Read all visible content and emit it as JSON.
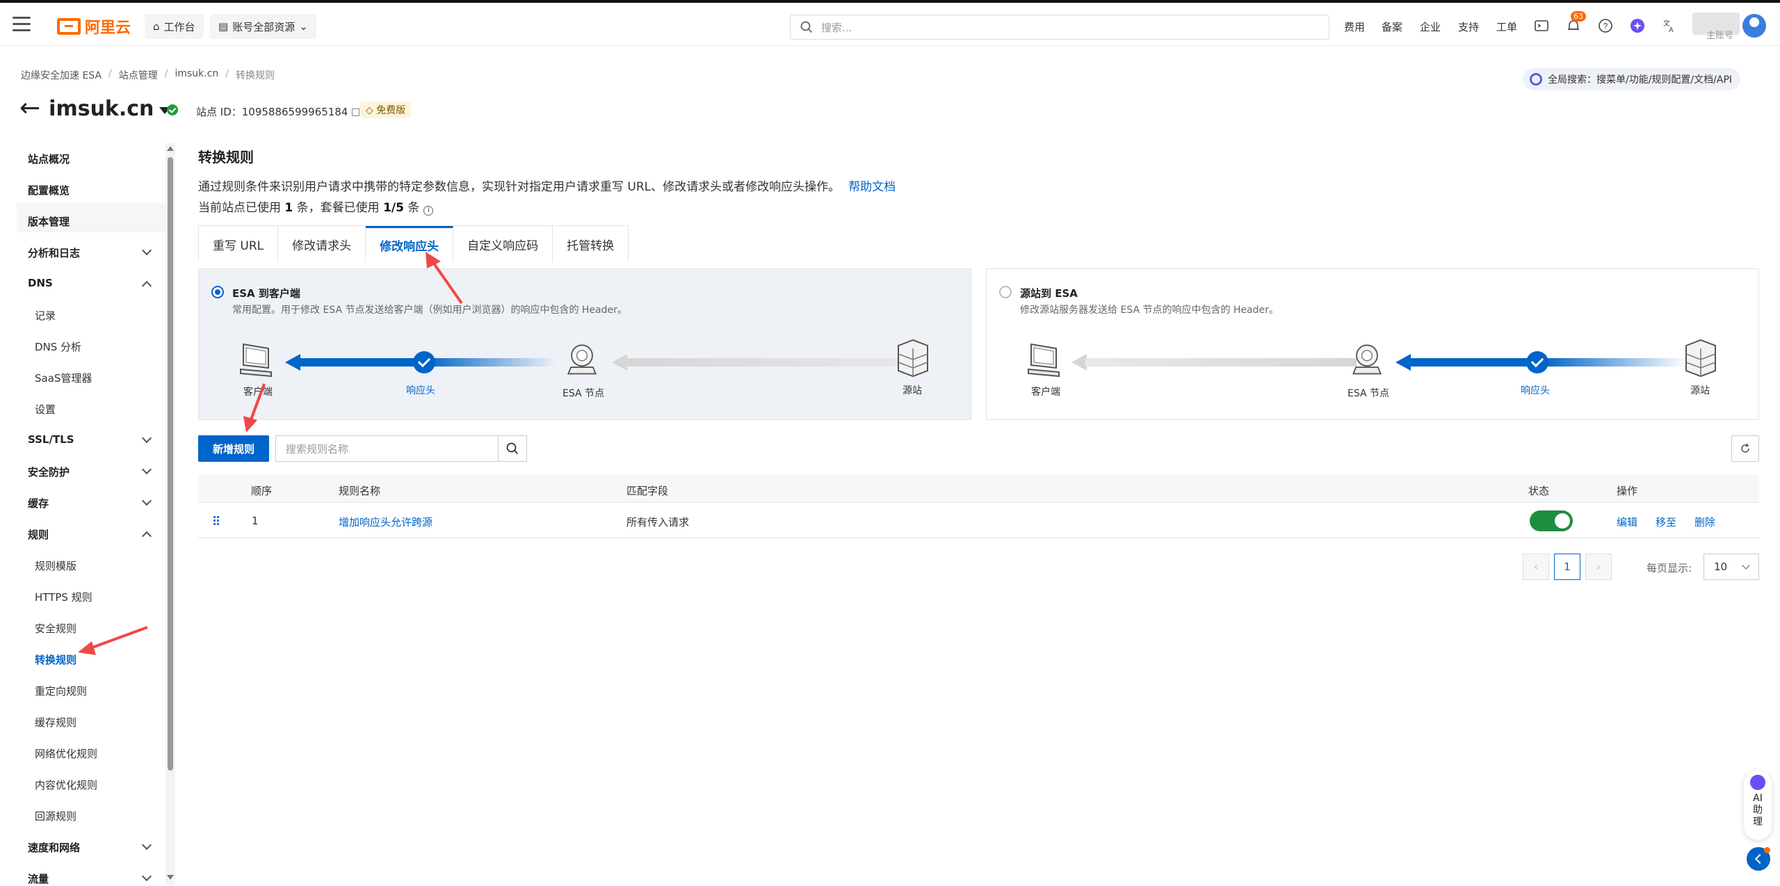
{
  "topbar": {
    "logo_text": "阿里云",
    "workbench": "工作台",
    "resources": "账号全部资源",
    "search_placeholder": "搜索...",
    "links": [
      "费用",
      "备案",
      "企业",
      "支持",
      "工单"
    ],
    "notification_count": "63",
    "user_name": "主账号"
  },
  "breadcrumb": [
    "边缘安全加速 ESA",
    "站点管理",
    "imsuk.cn",
    "转换规则"
  ],
  "global_search": "全局搜索：搜菜单/功能/规则配置/文档/API",
  "site": {
    "name": "imsuk.cn",
    "id_label": "站点 ID：1095886599965184",
    "plan_badge": "免费版"
  },
  "sidebar": {
    "items": [
      {
        "label": "站点概况",
        "type": "bold"
      },
      {
        "label": "配置概览",
        "type": "bold"
      },
      {
        "label": "版本管理",
        "type": "bold"
      },
      {
        "label": "分析和日志",
        "type": "bold"
      },
      {
        "label": "DNS",
        "type": "bold"
      },
      {
        "label": "记录",
        "type": "sub"
      },
      {
        "label": "DNS 分析",
        "type": "sub"
      },
      {
        "label": "SaaS管理器",
        "type": "sub"
      },
      {
        "label": "设置",
        "type": "sub"
      },
      {
        "label": "SSL/TLS",
        "type": "bold"
      },
      {
        "label": "安全防护",
        "type": "bold"
      },
      {
        "label": "缓存",
        "type": "bold"
      },
      {
        "label": "规则",
        "type": "bold"
      },
      {
        "label": "规则模版",
        "type": "sub"
      },
      {
        "label": "HTTPS 规则",
        "type": "sub"
      },
      {
        "label": "安全规则",
        "type": "sub"
      },
      {
        "label": "转换规则",
        "type": "active"
      },
      {
        "label": "重定向规则",
        "type": "sub"
      },
      {
        "label": "缓存规则",
        "type": "sub"
      },
      {
        "label": "网络优化规则",
        "type": "sub"
      },
      {
        "label": "内容优化规则",
        "type": "sub"
      },
      {
        "label": "回源规则",
        "type": "sub"
      },
      {
        "label": "速度和网络",
        "type": "bold"
      },
      {
        "label": "流量",
        "type": "bold"
      }
    ]
  },
  "page": {
    "title": "转换规则",
    "description": "通过规则条件来识别用户请求中携带的特定参数信息，实现针对指定用户请求重写 URL、修改请求头或者修改响应头操作。",
    "help_link": "帮助文档",
    "usage_prefix": "当前站点已使用 ",
    "usage_site": "1",
    "usage_mid": " 条，套餐已使用 ",
    "usage_plan": "1/5",
    "usage_suffix": " 条"
  },
  "tabs": [
    "重写 URL",
    "修改请求头",
    "修改响应头",
    "自定义响应码",
    "托管转换"
  ],
  "active_tab": "修改响应头",
  "cards": {
    "left": {
      "title": "ESA 到客户端",
      "subtitle": "常用配置。用于修改 ESA 节点发送给客户端（例如用户浏览器）的响应中包含的 Header。",
      "client": "客户端",
      "step": "响应头",
      "node": "ESA 节点",
      "origin": "源站"
    },
    "right": {
      "title": "源站到 ESA",
      "subtitle": "修改源站服务器发送给 ESA 节点的响应中包含的 Header。",
      "client": "客户端",
      "node": "ESA 节点",
      "step": "响应头",
      "origin": "源站"
    }
  },
  "toolbar": {
    "add_label": "新增规则",
    "search_placeholder": "搜索规则名称"
  },
  "table": {
    "headers": {
      "order": "顺序",
      "name": "规则名称",
      "match": "匹配字段",
      "status": "状态",
      "actions": "操作"
    },
    "rows": [
      {
        "order": "1",
        "name": "增加响应头允许跨源",
        "match": "所有传入请求",
        "status": "on",
        "edit": "编辑",
        "move": "移至",
        "delete": "删除"
      }
    ]
  },
  "pagination": {
    "current": "1",
    "per_page_label": "每页显示:",
    "per_page_value": "10"
  },
  "ai_assistant": "AI 助理",
  "colors": {
    "brand": "#ff6a00",
    "primary": "#0064c8",
    "toggle_on": "#1e8e3e",
    "annotation_arrow": "#f04848"
  }
}
